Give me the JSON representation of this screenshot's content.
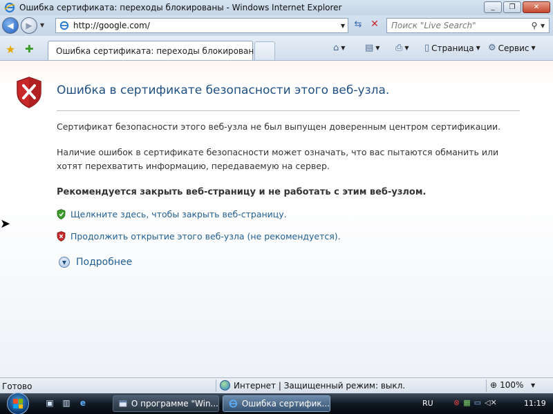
{
  "window": {
    "title": "Ошибка сертификата: переходы блокированы - Windows Internet Explorer",
    "minimize_label": "_",
    "maximize_label": "❐",
    "close_label": "✕"
  },
  "address": {
    "url": "http://google.com/",
    "search_placeholder": "Поиск \"Live Search\""
  },
  "tabs": [
    {
      "label": "Ошибка сертификата: переходы блокированы"
    }
  ],
  "command_bar": {
    "page_label": "Страница",
    "tools_label": "Сервис"
  },
  "page": {
    "title": "Ошибка в сертификате безопасности этого веб-узла.",
    "para1": "Сертификат безопасности этого веб-узла не был выпущен доверенным центром сертификации.",
    "para2": "Наличие ошибок в сертификате безопасности может означать, что вас пытаются обманить или хотят перехватить информацию, передаваемую на сервер.",
    "recommendation": "Рекомендуется закрыть веб-страницу и не работать с этим веб-узлом.",
    "close_link": "Щелкните здесь, чтобы закрыть веб-страницу.",
    "continue_link": "Продолжить открытие этого веб-узла (не рекомендуется).",
    "more_info": "Подробнее"
  },
  "statusbar": {
    "status": "Готово",
    "zone": "Интернет | Защищенный режим: выкл.",
    "zoom": "100%"
  },
  "taskbar": {
    "tasks": [
      {
        "label": "О программе \"Win..."
      },
      {
        "label": "Ошибка сертифик..."
      }
    ],
    "language": "RU",
    "time": "11:19"
  },
  "colors": {
    "link": "#1f5d94",
    "title": "#1f4f80",
    "shield_red": "#c8282a",
    "shield_green": "#3c9c2a"
  }
}
